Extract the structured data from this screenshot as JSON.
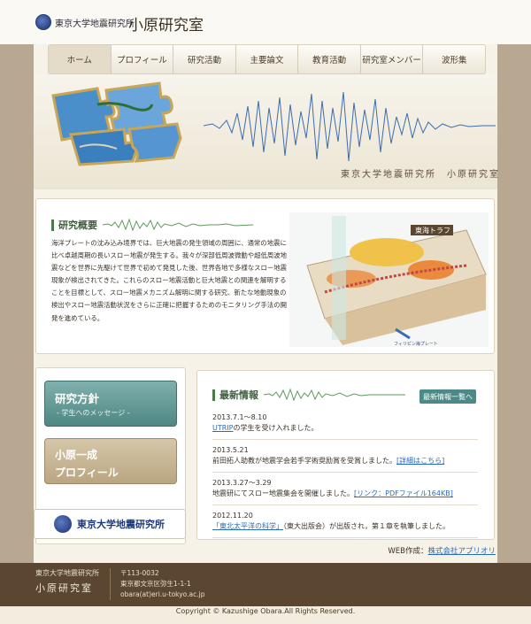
{
  "header": {
    "institute": "東京大学地震研究所",
    "lab_title": "小原研究室"
  },
  "nav": {
    "items": [
      "ホーム",
      "プロフィール",
      "研究活動",
      "主要論文",
      "教育活動",
      "研究室メンバー",
      "波形集"
    ]
  },
  "hero": {
    "subtitle": "東京大学地震研究所　小原研究室"
  },
  "overview": {
    "heading": "研究概要",
    "text": "海洋プレートの沈み込み境界では、巨大地震の発生領域の周囲に、通常の地震に比べ卓越周期の長いスロー地震が発生する。我々が深部低周波微動や超低周波地震などを世界に先駆けて世界で初めて発見した後、世界各地で多様なスロー地震現象が検出されてきた。これらのスロー地震活動と巨大地震との関連を解明することを目標として、スロー地震メカニズム解明に関する研究、新たな地動現象の検出やスロー地震活動状況をさらに正確に把握するためのモニタリング手法の開発を進めている。",
    "diagram": {
      "title": "東海トラフ",
      "plate": "フィリピン海プレート"
    }
  },
  "banners": {
    "research_policy": {
      "title": "研究方針",
      "sub": "- 学生へのメッセージ -"
    },
    "profile": {
      "line1": "小原一成",
      "line2": "プロフィール"
    },
    "eri": "東京大学地震研究所"
  },
  "news": {
    "heading": "最新情報",
    "more": "最新情報一覧へ",
    "items": [
      {
        "date": "2013.7.1〜8.10",
        "pre": "",
        "link": "UTRIP",
        "post": "の学生を受け入れました。"
      },
      {
        "date": "2013.5.21",
        "pre": "前田拓人助教が地震学会若手学術奨励賞を受賞しました。",
        "link": "[詳細はこちら]",
        "post": ""
      },
      {
        "date": "2013.3.27〜3.29",
        "pre": "地震研にてスロー地震集会を開催しました。",
        "link": "[リンク：PDFファイル164KB]",
        "post": ""
      },
      {
        "date": "2012.11.20",
        "pre": "",
        "link": "「東北太平洋の科学」",
        "post": "（東大出版会）が出版され，第１章を執筆しました。"
      }
    ]
  },
  "credit": {
    "label": "WEB作成：",
    "link": "株式会社アプリオリ"
  },
  "footer": {
    "institute": "東京大学地震研究所",
    "lab": "小原研究室",
    "postal": "〒113-0032",
    "address": "東京都文京区弥生1-1-1",
    "email": "obara(at)eri.u-tokyo.ac.jp",
    "copyright": "Copyright © Kazushige Obara.All Rights Reserved."
  },
  "colors": {
    "accent_green": "#4b7a4b",
    "teal": "#4e8783",
    "footer_brown": "#5a4631",
    "link_blue": "#2d6bb5"
  }
}
